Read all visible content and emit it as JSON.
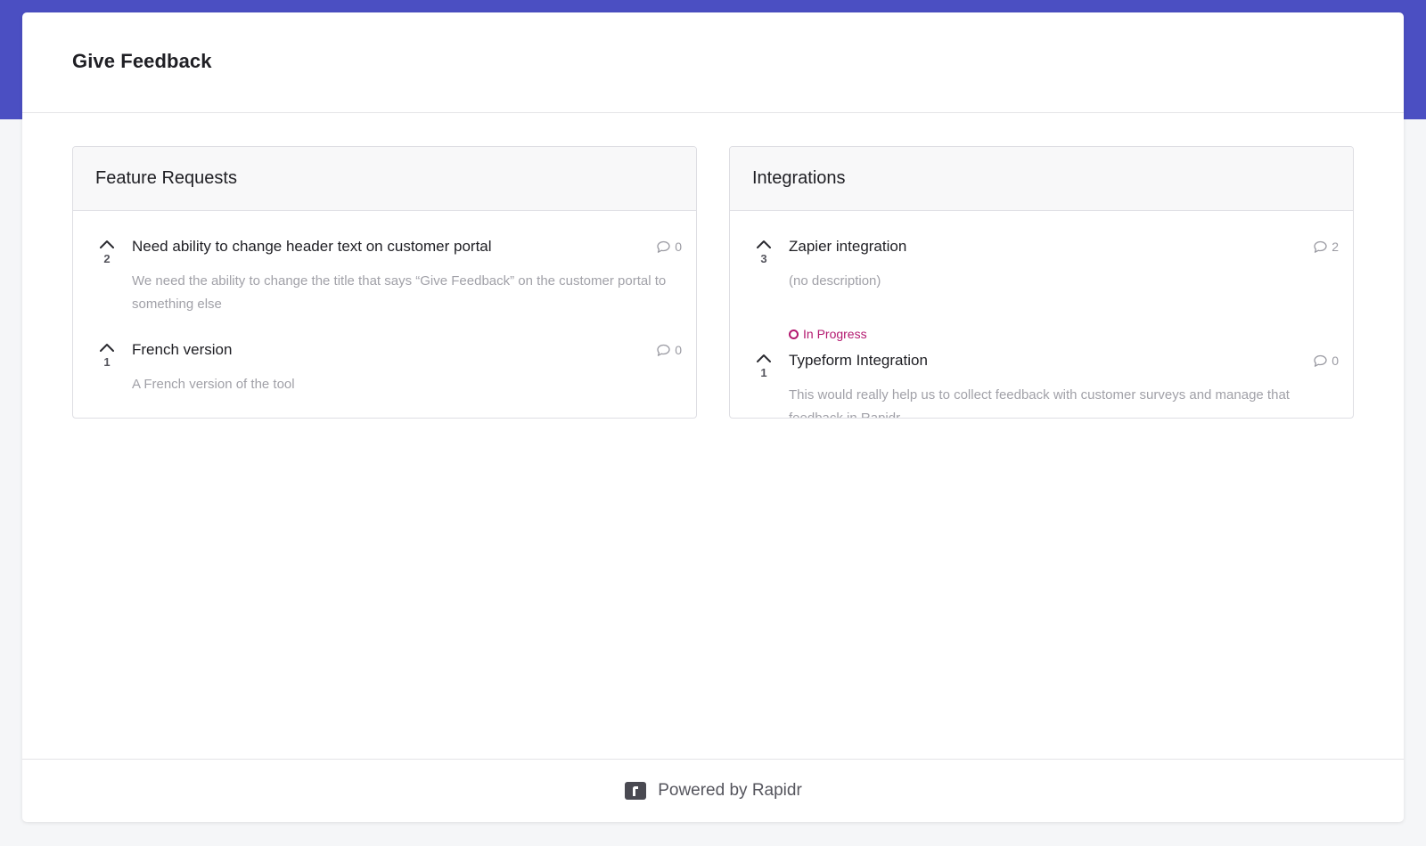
{
  "page": {
    "title": "Give Feedback"
  },
  "colors": {
    "brand_band": "#4b4fc2",
    "status_in_progress": "#b3186f"
  },
  "boards": [
    {
      "title": "Feature Requests",
      "posts": [
        {
          "votes": "2",
          "title": "Need ability to change header text on customer portal",
          "comments": "0",
          "description": "We need the ability to change the title that says “Give Feedback” on the customer portal to something else"
        },
        {
          "votes": "1",
          "title": "French version",
          "comments": "0",
          "description": "A French version of the tool"
        }
      ]
    },
    {
      "title": "Integrations",
      "posts": [
        {
          "votes": "3",
          "title": "Zapier integration",
          "comments": "2",
          "description": "(no description)",
          "status": "In Progress"
        },
        {
          "votes": "1",
          "title": "Typeform Integration",
          "comments": "0",
          "description": "This would really help us to collect feedback with customer surveys and manage that feedback in Rapidr"
        }
      ]
    }
  ],
  "icons": {
    "upvote": "chevron-up-icon",
    "comment": "speech-bubble-icon",
    "logo": "rapidr-logo-icon"
  },
  "footer": {
    "text": "Powered by Rapidr"
  }
}
